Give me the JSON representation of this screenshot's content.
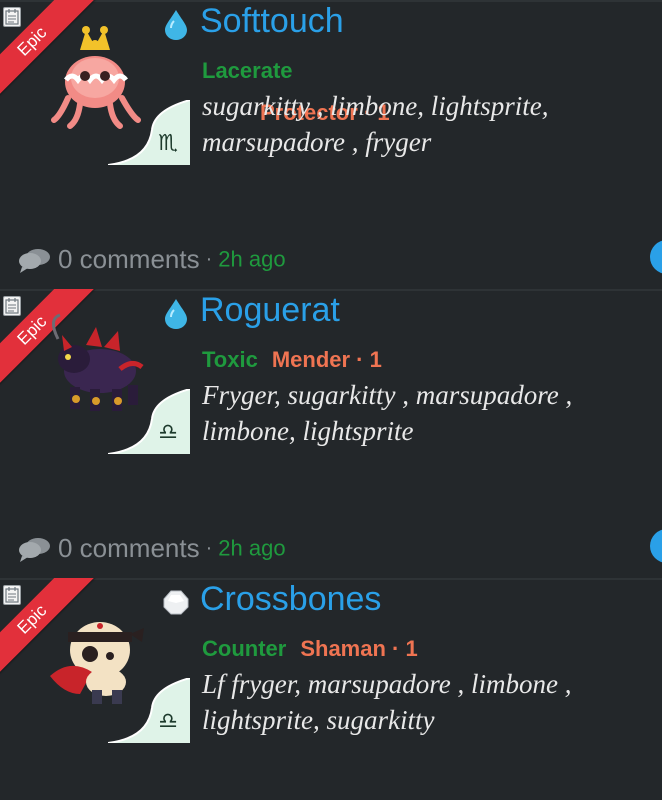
{
  "colors": {
    "background": "#1c1e20",
    "card": "#23272a",
    "name": "#2aa0e8",
    "type_tag": "#1f9a3e",
    "role_tag": "#ef7452",
    "ribbon": "#e2303b",
    "zodiac_bg": "#dff3e8"
  },
  "posts": [
    {
      "rarity": "Epic",
      "element_icon": "water-drop-icon",
      "name": "Softtouch",
      "type": "Lacerate",
      "role": "Protector · 1",
      "zodiac_symbol": "♏",
      "zodiac_icon": "scorpio-icon",
      "description": "sugarkitty , limbone, lightsprite, marsupadore , fryger",
      "comments": "0 comments",
      "separator": "·",
      "time": "2h ago"
    },
    {
      "rarity": "Epic",
      "element_icon": "water-drop-icon",
      "name": "Roguerat",
      "type": "Toxic",
      "role": "Mender · 1",
      "zodiac_symbol": "♎",
      "zodiac_icon": "libra-icon",
      "description": "Fryger, sugarkitty , marsupadore , limbone, lightsprite",
      "comments": "0 comments",
      "separator": "·",
      "time": "2h ago"
    },
    {
      "rarity": "Epic",
      "element_icon": "wind-gem-icon",
      "name": "Crossbones",
      "type": "Counter",
      "role": "Shaman · 1",
      "zodiac_symbol": "♎",
      "zodiac_icon": "libra-icon",
      "description": "Lf fryger, marsupadore , limbone , lightsprite, sugarkitty",
      "comments": "",
      "separator": "",
      "time": ""
    }
  ]
}
